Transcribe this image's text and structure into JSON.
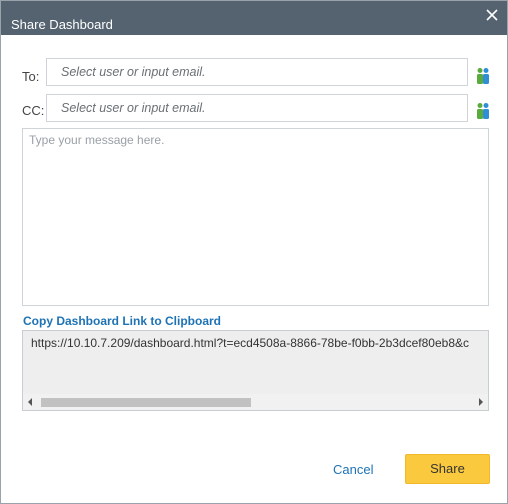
{
  "dialog": {
    "title": "Share Dashboard",
    "close_icon": "close-icon"
  },
  "to": {
    "label": "To:",
    "placeholder": "Select user or input email.",
    "value": "",
    "picker_icon": "people-icon"
  },
  "cc": {
    "label": "CC:",
    "placeholder": "Select user or input email.",
    "value": "",
    "picker_icon": "people-icon"
  },
  "message": {
    "placeholder": "Type your message here.",
    "value": ""
  },
  "link": {
    "copy_label": "Copy Dashboard Link to Clipboard",
    "url": "https://10.10.7.209/dashboard.html?t=ecd4508a-8866-78be-f0bb-2b3dcef80eb8&c"
  },
  "actions": {
    "cancel_label": "Cancel",
    "share_label": "Share"
  },
  "colors": {
    "titlebar": "#556270",
    "accent_link": "#1e73b5",
    "share_button": "#fbc93e",
    "people_icon_green": "#5aab3c",
    "people_icon_blue": "#2e8fd6"
  }
}
